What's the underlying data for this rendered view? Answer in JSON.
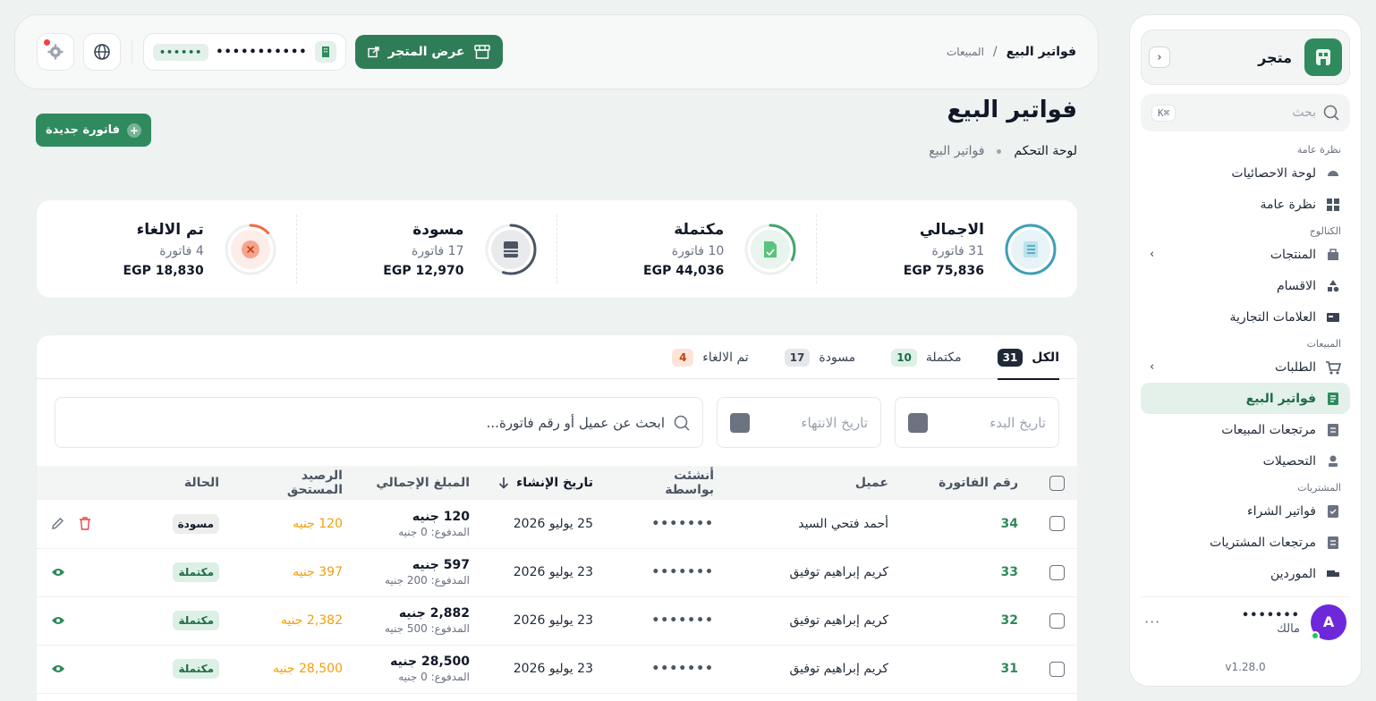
{
  "sidebar": {
    "brand_name": "متجر",
    "search_placeholder": "بحث",
    "search_shortcut": "⌘K",
    "sections": [
      {
        "title": "نظرة عامة",
        "items": [
          {
            "label": "لوحة الاحصائيات",
            "icon": "gauge-icon",
            "chevron": false,
            "active": false
          },
          {
            "label": "نظرة عامة",
            "icon": "grid-icon",
            "chevron": false,
            "active": false
          }
        ]
      },
      {
        "title": "الكتالوج",
        "items": [
          {
            "label": "المنتجات",
            "icon": "box-icon",
            "chevron": true,
            "active": false
          },
          {
            "label": "الاقسام",
            "icon": "shapes-icon",
            "chevron": false,
            "active": false
          },
          {
            "label": "العلامات التجارية",
            "icon": "tag-icon",
            "chevron": false,
            "active": false
          }
        ]
      },
      {
        "title": "المبيعات",
        "items": [
          {
            "label": "الطلبات",
            "icon": "cart-icon",
            "chevron": true,
            "active": false
          },
          {
            "label": "فواتير البيع",
            "icon": "invoice-icon",
            "chevron": false,
            "active": true
          },
          {
            "label": "مرتجعات المبيعات",
            "icon": "return-icon",
            "chevron": false,
            "active": false
          },
          {
            "label": "التحصيلات",
            "icon": "coins-icon",
            "chevron": false,
            "active": false
          }
        ]
      },
      {
        "title": "المشتريات",
        "items": [
          {
            "label": "فواتير الشراء",
            "icon": "receipt-icon",
            "chevron": false,
            "active": false
          },
          {
            "label": "مرتجعات المشتريات",
            "icon": "return-icon",
            "chevron": false,
            "active": false
          },
          {
            "label": "الموردين",
            "icon": "truck-icon",
            "chevron": false,
            "active": false
          }
        ]
      }
    ],
    "user": {
      "initial": "A",
      "name": "•••••••",
      "role": "مالك",
      "more": "···"
    },
    "version": "v1.28.0"
  },
  "topbar": {
    "breadcrumb_current": "فواتير البيع",
    "breadcrumb_sep": "/",
    "breadcrumb_prev": "المبيعات",
    "view_store_label": "عرض المتجر",
    "store_name": "•••••••••••",
    "store_tag": "••••••"
  },
  "page": {
    "title": "فواتير البيع",
    "crumb_first": "لوحة التحكم",
    "crumb_last": "فواتير البيع",
    "new_invoice_label": "فاتورة جديدة",
    "new_invoice_plus": "+"
  },
  "stats": [
    {
      "title": "الاجمالي",
      "count": "31 فاتورة",
      "amount": "EGP 75,836",
      "color": "#3b9fb8",
      "progress": 1.0,
      "icon": "list-icon"
    },
    {
      "title": "مكتملة",
      "count": "10 فاتورة",
      "amount": "EGP 44,036",
      "color": "#3fa56a",
      "progress": 0.32,
      "icon": "check-file-icon"
    },
    {
      "title": "مسودة",
      "count": "17 فاتورة",
      "amount": "EGP 12,970",
      "color": "#4b5563",
      "progress": 0.55,
      "icon": "draft-icon"
    },
    {
      "title": "تم الالغاء",
      "count": "4 فاتورة",
      "amount": "EGP 18,830",
      "color": "#ef6a4a",
      "progress": 0.13,
      "icon": "x-icon"
    }
  ],
  "tabs": [
    {
      "label": "الكل",
      "count": "31",
      "style": "b-dark",
      "active": true
    },
    {
      "label": "مكتملة",
      "count": "10",
      "style": "b-green",
      "active": false
    },
    {
      "label": "مسودة",
      "count": "17",
      "style": "b-gray",
      "active": false
    },
    {
      "label": "تم الالغاء",
      "count": "4",
      "style": "b-red",
      "active": false
    }
  ],
  "filters": {
    "start_placeholder": "تاريخ البدء",
    "end_placeholder": "تاريخ الانتهاء",
    "search_placeholder": "ابحث عن عميل أو رقم فاتورة..."
  },
  "table": {
    "headers": {
      "number": "رقم الفاتورة",
      "customer": "عميل",
      "created_by": "أنشئت بواسطة",
      "created_at": "تاريخ الإنشاء",
      "total": "المبلغ الإجمالي",
      "due": "الرصيد المستحق",
      "status": "الحالة"
    },
    "rows": [
      {
        "number": "34",
        "customer": "أحمد فتحي السيد",
        "created_by": "•••••••",
        "date": "25 يوليو 2026",
        "total": "120 جنيه",
        "paid": "المدفوع: 0 جنيه",
        "due": "120 جنيه",
        "status": "مسودة",
        "status_kind": "draft"
      },
      {
        "number": "33",
        "customer": "كريم إبراهيم توفيق",
        "created_by": "•••••••",
        "date": "23 يوليو 2026",
        "total": "597 جنيه",
        "paid": "المدفوع: 200 جنيه",
        "due": "397 جنيه",
        "status": "مكتملة",
        "status_kind": "done"
      },
      {
        "number": "32",
        "customer": "كريم إبراهيم توفيق",
        "created_by": "•••••••",
        "date": "23 يوليو 2026",
        "total": "2,882 جنيه",
        "paid": "المدفوع: 500 جنيه",
        "due": "2,382 جنيه",
        "status": "مكتملة",
        "status_kind": "done"
      },
      {
        "number": "31",
        "customer": "كريم إبراهيم توفيق",
        "created_by": "•••••••",
        "date": "23 يوليو 2026",
        "total": "28,500 جنيه",
        "paid": "المدفوع: 0 جنيه",
        "due": "28,500 جنيه",
        "status": "مكتملة",
        "status_kind": "done"
      }
    ]
  }
}
